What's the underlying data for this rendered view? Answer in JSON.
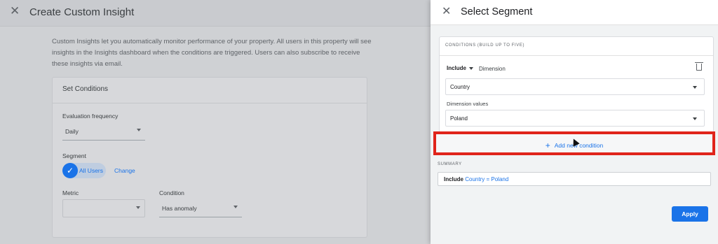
{
  "background": {
    "title": "Create Custom Insight",
    "description": "Custom Insights let you automatically monitor performance of your property. All users in this property will see insights in the Insights dashboard when the conditions are triggered. Users can also subscribe to receive these insights via email.",
    "card_title": "Set Conditions",
    "evaluation_frequency_label": "Evaluation frequency",
    "evaluation_frequency_value": "Daily",
    "segment_label": "Segment",
    "segment_value": "All Users",
    "segment_change": "Change",
    "metric_label": "Metric",
    "metric_value": "",
    "condition_label": "Condition",
    "condition_value": "Has anomaly"
  },
  "panel": {
    "title": "Select Segment",
    "conditions_header": "CONDITIONS (BUILD UP TO FIVE)",
    "include_label": "Include",
    "dimension_label": "Dimension",
    "dimension_value": "Country",
    "dimension_values_label": "Dimension values",
    "dimension_values_value": "Poland",
    "add_condition_label": "Add new condition",
    "summary_label": "SUMMARY",
    "summary_include": "Include",
    "summary_value": "Country = Poland",
    "apply_label": "Apply"
  },
  "colors": {
    "accent": "#1a73e8",
    "highlight": "#e0241b"
  },
  "icons": {
    "close": "close-icon",
    "check": "check-icon",
    "trash": "trash-icon",
    "add": "plus-icon"
  }
}
